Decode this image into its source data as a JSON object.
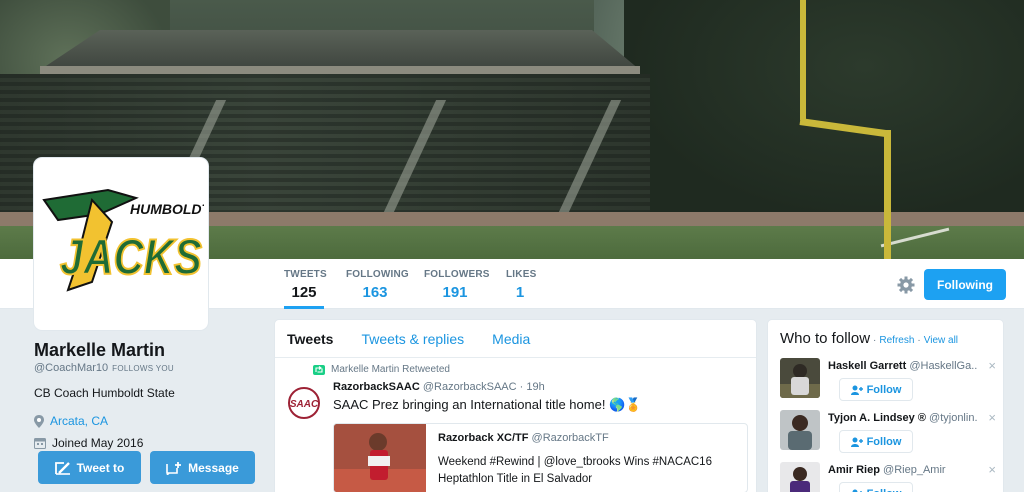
{
  "profile": {
    "name": "Markelle Martin",
    "screen_name": "@CoachMar10",
    "follows_you": "FOLLOWS YOU",
    "bio": "CB Coach Humboldt State",
    "location": "Arcata, CA",
    "joined": "Joined May 2016",
    "avatar_logo": {
      "top": "HUMBOLDT S",
      "main": "JACKS"
    }
  },
  "stats": [
    {
      "label": "TWEETS",
      "value": "125"
    },
    {
      "label": "FOLLOWING",
      "value": "163"
    },
    {
      "label": "FOLLOWERS",
      "value": "191"
    },
    {
      "label": "LIKES",
      "value": "1"
    }
  ],
  "actions": {
    "following": "Following",
    "tweet_to": "Tweet to",
    "message": "Message"
  },
  "timeline": {
    "tabs": [
      "Tweets",
      "Tweets & replies",
      "Media"
    ],
    "tweet": {
      "retweeted_by": "Markelle Martin Retweeted",
      "name": "RazorbackSAAC",
      "handle": "@RazorbackSAAC",
      "time": "· 19h",
      "text": "SAAC Prez bringing an International title home! 🌎🏅",
      "avatar_text": "SAAC",
      "quote": {
        "name": "Razorback XC/TF",
        "handle": "@RazorbackTF",
        "text": "Weekend #Rewind | @love_tbrooks Wins #NACAC16 Heptathlon Title in El Salvador"
      }
    }
  },
  "who_to_follow": {
    "title": "Who to follow",
    "separator": "·",
    "refresh": "Refresh",
    "view_all": "View all",
    "follow_label": "Follow",
    "close": "×",
    "users": [
      {
        "name": "Haskell Garrett",
        "handle": "@HaskellGa..."
      },
      {
        "name": "Tyjon A. Lindsey",
        "verified": "®",
        "handle": "@tyjonlin..."
      },
      {
        "name": "Amir Riep",
        "handle": "@Riep_Amir"
      }
    ]
  },
  "colors": {
    "accent": "#1da1f2",
    "link": "#1b95e0",
    "jacks_green": "#1f6b35",
    "jacks_gold": "#f2c230"
  }
}
